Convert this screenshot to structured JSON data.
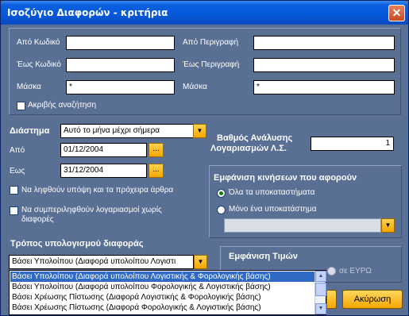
{
  "window": {
    "title": "Ισοζύγιο Διαφορών - κριτήρια",
    "close_glyph": "✕"
  },
  "criteria": {
    "from_code_label": "Από Κωδικό",
    "to_code_label": "Έως Κωδικό",
    "mask_label": "Μάσκα",
    "from_desc_label": "Από Περιγραφή",
    "to_desc_label": "Έως Περιγραφή",
    "mask_desc_label": "Μάσκα",
    "from_code_value": "",
    "to_code_value": "",
    "mask_value": "*",
    "from_desc_value": "",
    "to_desc_value": "",
    "mask_desc_value": "*",
    "exact_search_label": "Ακριβής αναζήτηση",
    "exact_search_checked": false
  },
  "period": {
    "label": "Διάστημα",
    "selected": "Αυτό το μήνα μέχρι σήμερα",
    "from_label": "Από",
    "from_value": "01/12/2004",
    "to_label": "Εως",
    "to_value": "31/12/2004",
    "dots": "...",
    "include_drafts_label": "Να ληφθούν υπόψη και τα πρόχειρα άρθρα",
    "include_drafts_checked": false,
    "include_no_diff_label_1": "Να συμπεριληφθούν λογαριασμοί χωρίς",
    "include_no_diff_label_2": "διαφορές",
    "include_no_diff_checked": false
  },
  "analysis": {
    "label_1": "Βαθμός Ανάλυσης",
    "label_2": "Λογαριασμών Λ.Σ.",
    "value": "1"
  },
  "movements": {
    "title": "Εμφάνιση κινήσεων που αφορούν",
    "all_branches_label": "Όλα τα υποκαταστήματα",
    "one_branch_label": "Μόνο ένα υποκατάστημα",
    "selected": "all",
    "branch_value": ""
  },
  "diff_method": {
    "label": "Τρόπος υπολογισμού διαφοράς",
    "selected": "Βάσει Υπολοίπου (Διαφορά υπολοίπου Λογιστι",
    "options": [
      "Βάσει Υπολοίπου (Διαφορά υπολοίπου Λογιστικής & Φορολογικής βάσης)",
      "Βάσει Υπολοίπου (Διαφορά υπολοίπου Φορολογικής & Λογιστικής βάσης)",
      "Βάσει Χρέωσης Πίστωσης (Διαφορά Λογιστικής & Φορολογικής βάσης)",
      "Βάσει Χρέωσης Πίστωσης (Διαφορά Φορολογικής & Λογιστικής βάσης)"
    ],
    "highlighted_index": 0
  },
  "values_display": {
    "title": "Εμφάνιση Τιμών",
    "euro_label": "σε ΕΥΡΩ"
  },
  "buttons": {
    "cancel_label": "Ακύρωση"
  },
  "icons": {
    "dropdown": "▼",
    "scroll_up": "▲",
    "scroll_down": "▼"
  },
  "colors": {
    "dialog_bg": "#596f94",
    "title_bar": "#0558d8",
    "button_accent": "#f4a600",
    "highlight": "#316ac5"
  }
}
